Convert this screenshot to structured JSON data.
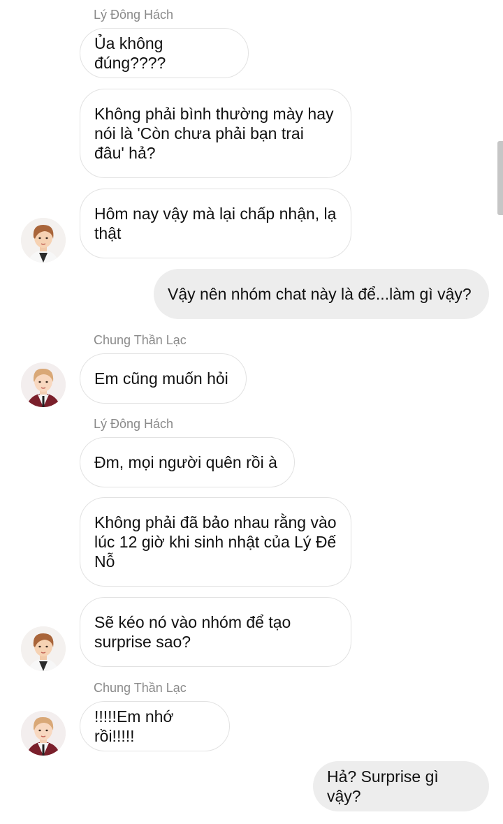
{
  "messages": {
    "s1": "Lý Đông Hách",
    "m1": "Ủa không đúng????",
    "m2": "Không phải bình thường mày hay nói là 'Còn chưa phải bạn trai đâu' hả?",
    "m3": "Hôm nay vậy mà lại chấp nhận, lạ thật",
    "m4": "Vậy nên nhóm chat này là để...làm gì vậy?",
    "s2": "Chung Thần Lạc",
    "m5": "Em cũng muốn hỏi",
    "s3": "Lý Đông Hách",
    "m6": "Đm, mọi người quên rồi à",
    "m7": "Không phải đã bảo nhau rằng vào lúc 12 giờ khi sinh nhật của Lý Đế Nỗ",
    "m8": "Sẽ kéo nó vào nhóm để tạo surprise sao?",
    "s4": "Chung Thần Lạc",
    "m9": "!!!!!Em nhớ rồi!!!!!",
    "m10": "Hả? Surprise gì vậy?"
  },
  "colors": {
    "incoming_bubble": "#ffffff",
    "outgoing_bubble": "#ededed",
    "sender_name": "#8a8a8a"
  }
}
